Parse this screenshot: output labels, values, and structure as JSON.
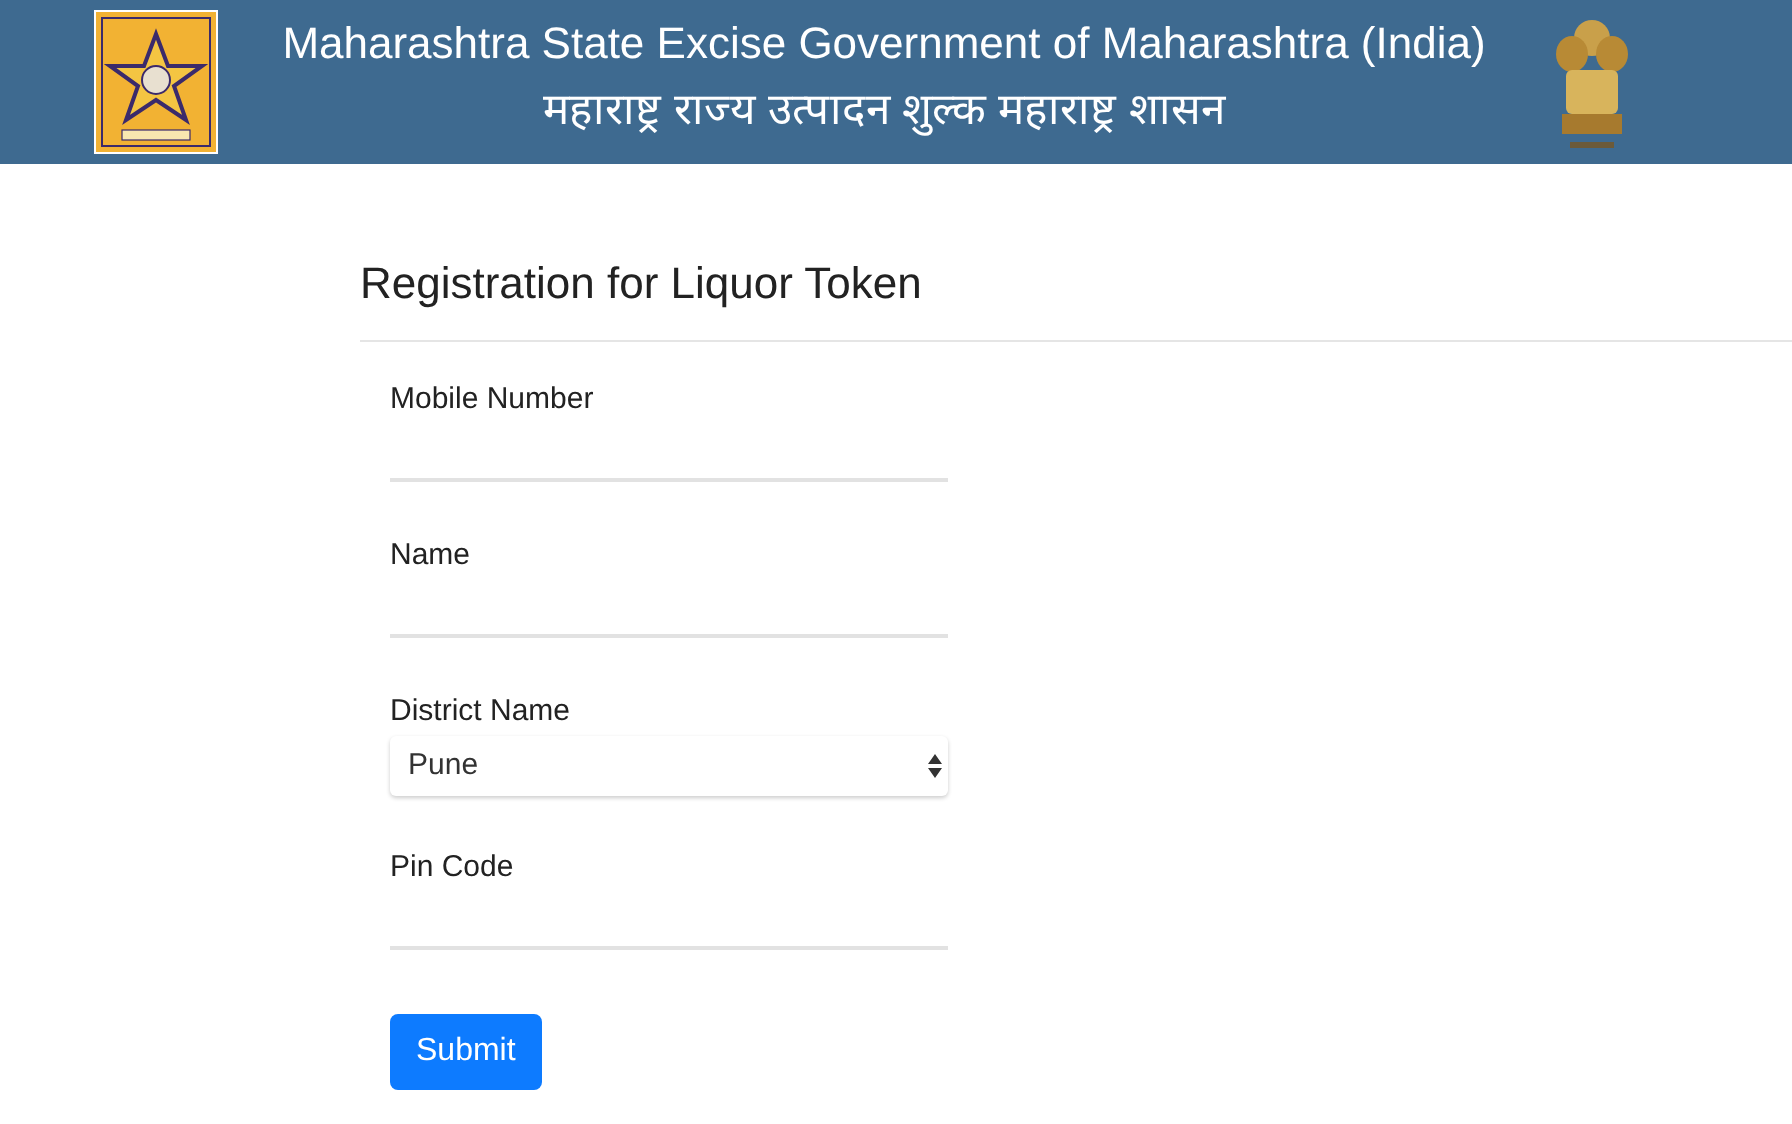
{
  "header": {
    "title": "Maharashtra State Excise Government of Maharashtra (India)",
    "subtitle": "महाराष्ट्र राज्य उत्पादन शुल्क महाराष्ट्र शासन"
  },
  "form": {
    "title": "Registration for Liquor Token",
    "fields": [
      {
        "kind": "text",
        "label": "Mobile Number"
      },
      {
        "kind": "text",
        "label": "Name"
      },
      {
        "kind": "select",
        "label": "District Name",
        "value": "Pune"
      },
      {
        "kind": "text",
        "label": "Pin Code"
      }
    ],
    "submit": "Submit"
  }
}
